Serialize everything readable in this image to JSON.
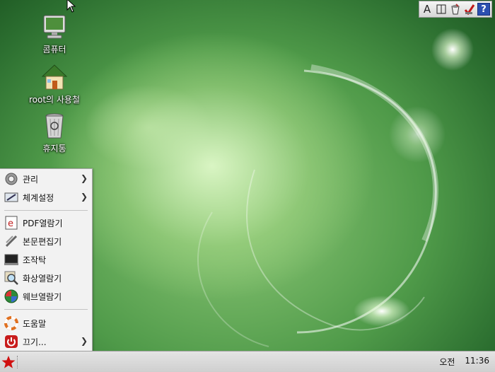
{
  "desktop": {
    "icons": [
      {
        "label": "콤퓨터",
        "icon": "computer-monitor-icon"
      },
      {
        "label": "root의 사용철",
        "icon": "home-folder-icon"
      },
      {
        "label": "휴지통",
        "icon": "trash-bin-icon"
      }
    ]
  },
  "tray": {
    "items": [
      {
        "icon": "input-method-A-icon",
        "text": "A"
      },
      {
        "icon": "split-window-icon"
      },
      {
        "icon": "cup-tool-icon"
      },
      {
        "icon": "checkmark-tool-icon"
      },
      {
        "icon": "help-icon",
        "text": "?"
      }
    ]
  },
  "start_menu": {
    "items": [
      {
        "label": "관리",
        "icon": "gear-icon",
        "submenu": true
      },
      {
        "label": "체계설정",
        "icon": "settings-panel-icon",
        "submenu": true
      },
      {
        "label": "PDF열람기",
        "icon": "pdf-reader-icon"
      },
      {
        "label": "본문편집기",
        "icon": "text-editor-pen-icon"
      },
      {
        "label": "조작탁",
        "icon": "terminal-icon"
      },
      {
        "label": "화상열람기",
        "icon": "image-viewer-magnifier-icon"
      },
      {
        "label": "웨브열람기",
        "icon": "web-browser-globe-icon"
      },
      {
        "label": "도움말",
        "icon": "help-lifebuoy-icon"
      },
      {
        "label": "끄기...",
        "icon": "power-icon",
        "submenu": true
      }
    ]
  },
  "taskbar": {
    "start_icon": "red-star-icon",
    "clock": {
      "period": "오전",
      "time": "11:36"
    }
  },
  "colors": {
    "start_star": "#d01010",
    "menu_bg": "#f2f2f2",
    "taskbar": "#d8d8d8"
  }
}
